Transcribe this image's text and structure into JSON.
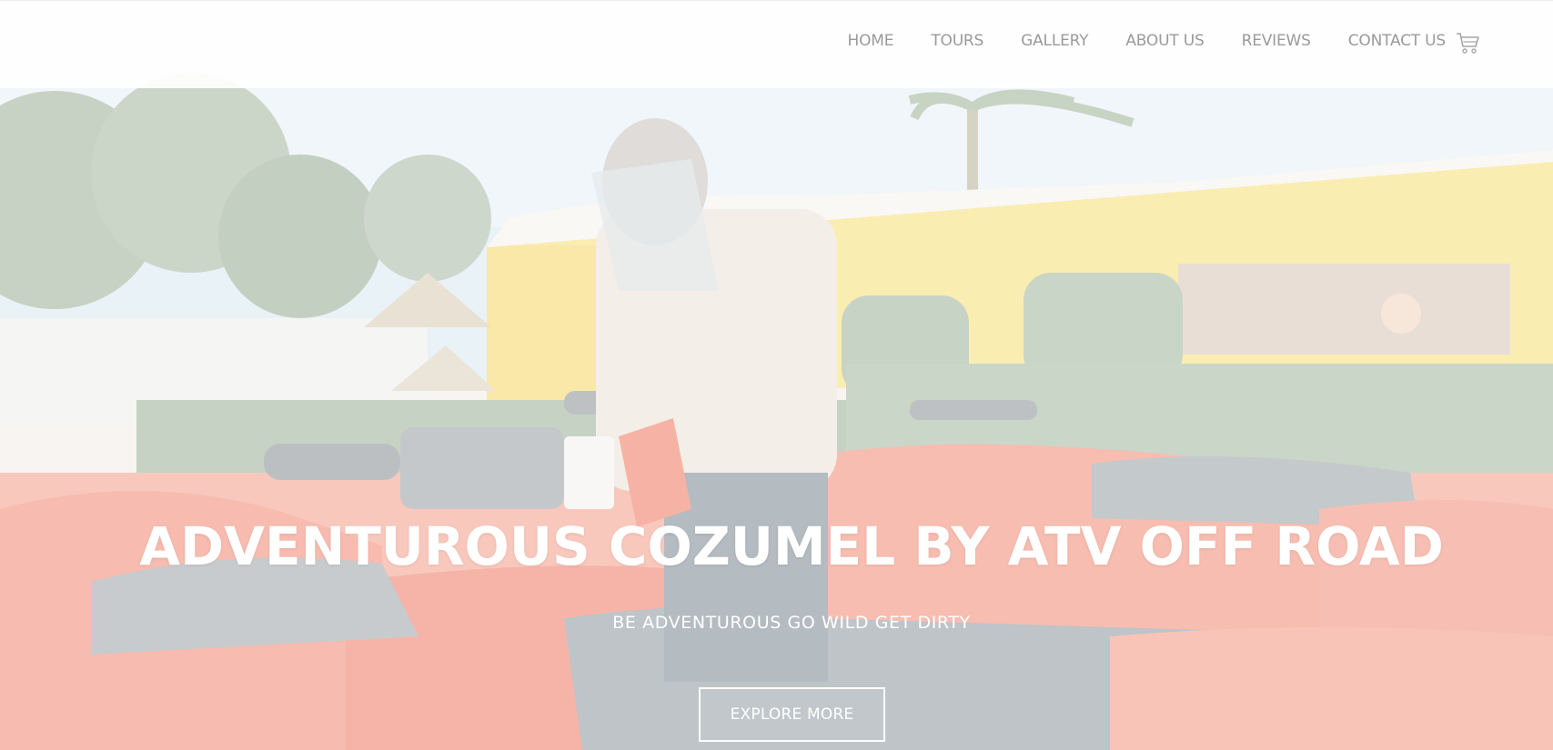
{
  "nav": {
    "items": [
      {
        "label": "HOME"
      },
      {
        "label": "TOURS"
      },
      {
        "label": "GALLERY"
      },
      {
        "label": "ABOUT US"
      },
      {
        "label": "REVIEWS"
      },
      {
        "label": "CONTACT US"
      }
    ],
    "cart_icon": "shopping-cart-icon"
  },
  "hero": {
    "headline": "ADVENTUROUS COZUMEL BY ATV OFF ROAD",
    "subtitle": "BE ADVENTUROUS GO WILD GET DIRTY",
    "cta_label": "EXPLORE MORE",
    "background": "photo of a man in a face shield wiping red ATV quad bikes in front of a yellow building"
  },
  "colors": {
    "nav_text": "#9a9a9a",
    "hero_text": "#ffffff",
    "atv_red": "#f1836c",
    "building_yellow": "#f7e07b",
    "sky": "#cfe3ee"
  }
}
